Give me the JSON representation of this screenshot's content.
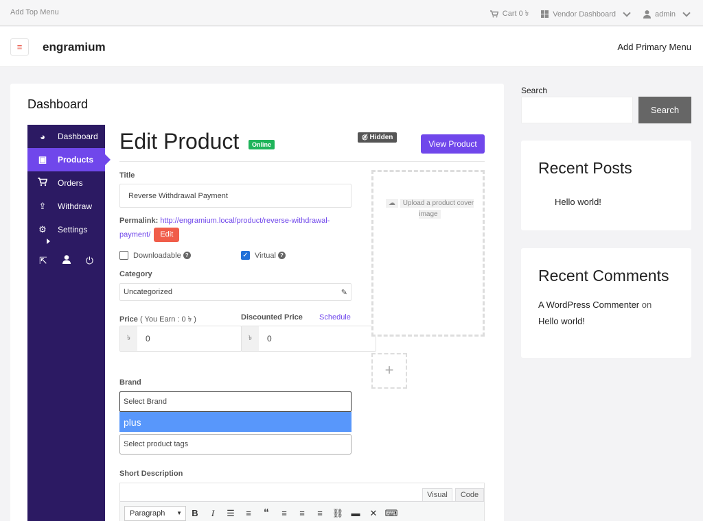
{
  "topbar": {
    "left_menu": "Add Top Menu",
    "cart": "Cart 0 ৳",
    "vendor_dashboard": "Vendor Dashboard",
    "user": "admin"
  },
  "header": {
    "site_name": "engramium",
    "primary_menu": "Add Primary Menu"
  },
  "page": {
    "title": "Dashboard"
  },
  "sidebar": {
    "items": [
      {
        "label": "Dashboard",
        "icon": "dashboard-icon"
      },
      {
        "label": "Products",
        "icon": "briefcase-icon",
        "active": true
      },
      {
        "label": "Orders",
        "icon": "cart-icon"
      },
      {
        "label": "Withdraw",
        "icon": "upload-icon"
      },
      {
        "label": "Settings",
        "icon": "gear-icon"
      }
    ],
    "bottom_icons": [
      "external-link-icon",
      "user-icon",
      "power-icon"
    ]
  },
  "product": {
    "heading": "Edit Product",
    "status_badge": "Online",
    "visibility_badge": "Hidden",
    "view_button": "View Product",
    "title_label": "Title",
    "title_value": "Reverse Withdrawal Payment",
    "permalink_label": "Permalink:",
    "permalink_url": "http://engramium.local/product/reverse-withdrawal-payment/",
    "permalink_edit": "Edit",
    "downloadable_label": "Downloadable",
    "downloadable_checked": false,
    "virtual_label": "Virtual",
    "virtual_checked": true,
    "category_label": "Category",
    "category_value": "Uncategorized",
    "price_label": "Price",
    "price_earn": "( You Earn : 0 ৳ )",
    "price_value": "0",
    "currency_symbol": "৳",
    "discount_label": "Discounted Price",
    "schedule_link": "Schedule",
    "discount_value": "0",
    "cover_upload": "Upload a product cover image",
    "gallery_add": "+",
    "brand_label": "Brand",
    "brand_placeholder": "Select Brand",
    "brand_option": "plus",
    "tags_placeholder": "Select product tags",
    "short_desc_label": "Short Description",
    "editor_tab_visual": "Visual",
    "editor_tab_code": "Code",
    "editor_format": "Paragraph"
  },
  "widgets": {
    "search_label": "Search",
    "search_button": "Search",
    "recent_posts_title": "Recent Posts",
    "recent_post": "Hello world!",
    "recent_comments_title": "Recent Comments",
    "comment_author": "A WordPress Commenter",
    "comment_on": "on",
    "comment_post": "Hello world!"
  },
  "colors": {
    "accent": "#7047eb",
    "sidebar_bg": "#2c1a63",
    "online": "#1fb45a",
    "edit": "#f05d4a",
    "dropdown_highlight": "#5897fb"
  }
}
